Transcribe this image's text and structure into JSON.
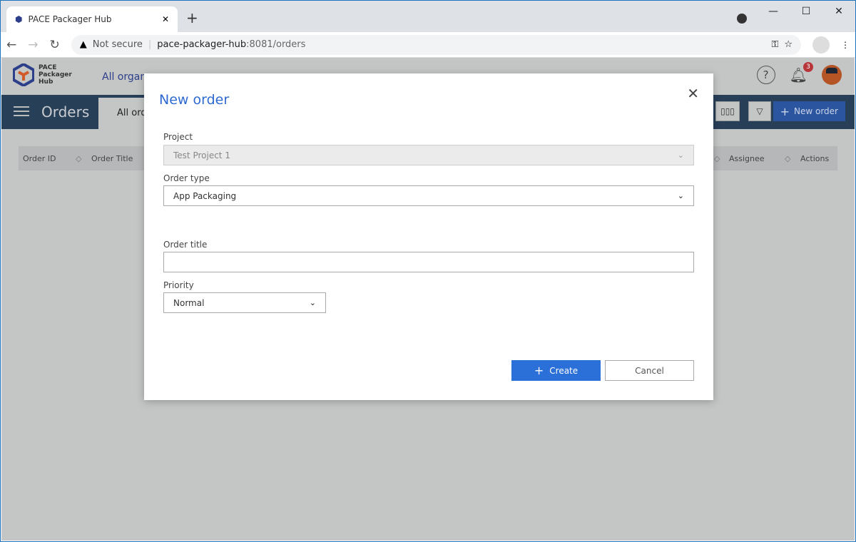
{
  "browser": {
    "tab_title": "PACE Packager Hub",
    "new_tab": "+",
    "minimize": "—",
    "maximize": "☐",
    "close": "✕",
    "not_secure": "Not secure",
    "url_host": "pace-packager-hub",
    "url_rest": ":8081/orders"
  },
  "app": {
    "logo_text": [
      "PACE",
      "Packager",
      "Hub"
    ],
    "org": "All organ",
    "notifications": "3",
    "page_title": "Orders",
    "subtab": "All orders",
    "new_order": "New order",
    "columns": [
      "Order ID",
      "Order Title",
      "Assignee",
      "Actions"
    ]
  },
  "modal": {
    "title": "New order",
    "close": "✕",
    "project_label": "Project",
    "project_value": "Test Project 1",
    "type_label": "Order type",
    "type_value": "App Packaging",
    "title_label": "Order title",
    "title_value": "",
    "priority_label": "Priority",
    "priority_value": "Normal",
    "create": "Create",
    "cancel": "Cancel"
  },
  "colors": {
    "accent": "#2b6fd8",
    "header": "#283f58"
  }
}
